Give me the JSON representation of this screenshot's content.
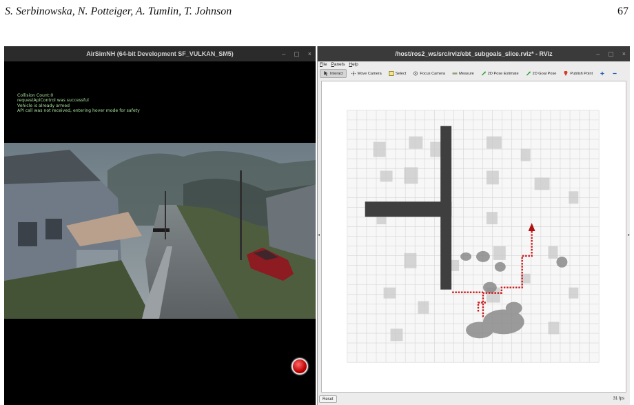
{
  "header": {
    "authors": "S. Serbinowska, N. Potteiger, A. Tumlin, T. Johnson",
    "page_number": "67"
  },
  "airsim": {
    "title": "AirSimNH (64-bit Development SF_VULKAN_SM5)",
    "window_controls": [
      "–",
      "▢",
      "×"
    ],
    "log_lines": [
      "Collision Count:0",
      "requestApiControl was successful",
      "Vehicle is already armed",
      "API call was not received, entering hover mode for safety"
    ]
  },
  "rviz": {
    "title": "/host/ros2_ws/src/rviz/ebt_subgoals_slice.rviz* - RViz",
    "window_controls": [
      "–",
      "▢",
      "×"
    ],
    "menu": [
      "File",
      "Panels",
      "Help"
    ],
    "tools": [
      {
        "label": "Interact",
        "icon": "cursor-icon"
      },
      {
        "label": "Move Camera",
        "icon": "move-camera-icon"
      },
      {
        "label": "Select",
        "icon": "select-icon"
      },
      {
        "label": "Focus Camera",
        "icon": "focus-camera-icon"
      },
      {
        "label": "Measure",
        "icon": "measure-icon"
      },
      {
        "label": "2D Pose Estimate",
        "icon": "pose-estimate-icon"
      },
      {
        "label": "2D Goal Pose",
        "icon": "goal-pose-icon"
      },
      {
        "label": "Publish Point",
        "icon": "publish-point-icon"
      },
      {
        "label": "",
        "icon": "plus-icon"
      },
      {
        "label": "",
        "icon": "minus-icon"
      }
    ],
    "reset_label": "Reset",
    "fps": "31 fps",
    "colors": {
      "obstacle": "#3f3f3f",
      "path": "#cc1a1a",
      "grid": "#d4d4d4"
    }
  }
}
